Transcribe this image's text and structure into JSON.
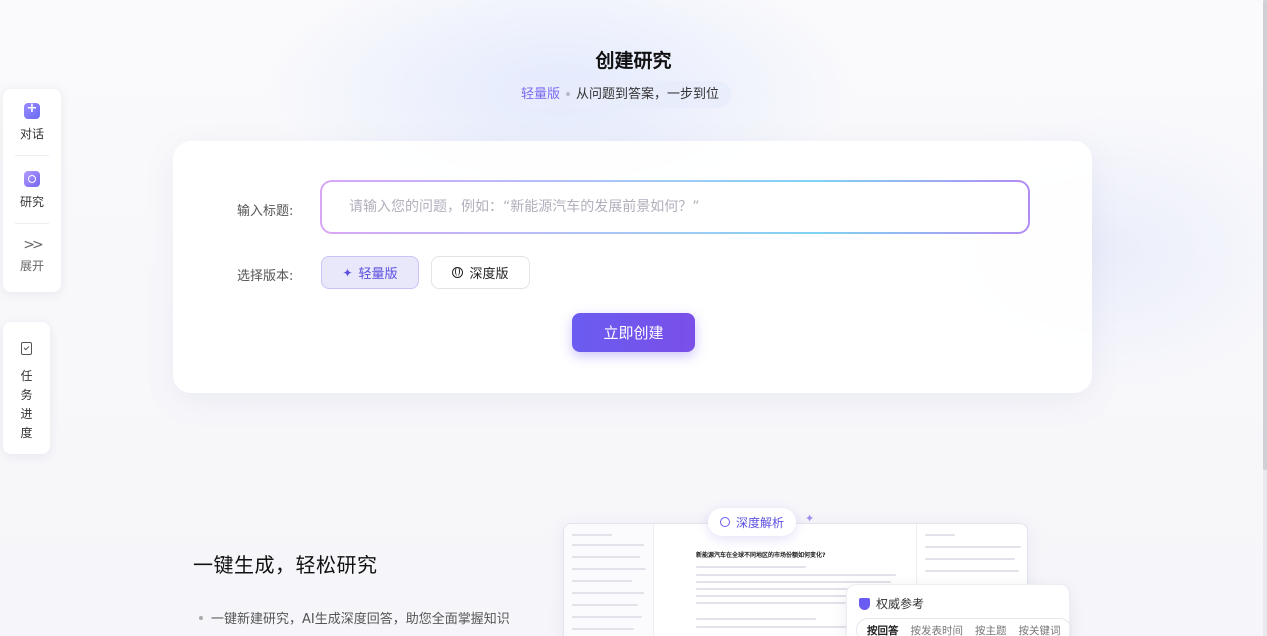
{
  "header": {
    "title": "创建研究",
    "subtitle_version": "轻量版",
    "subtitle_text": "从问题到答案，一步到位"
  },
  "sidebar": {
    "items": [
      {
        "label": "对话",
        "icon": "chat-plus-icon"
      },
      {
        "label": "研究",
        "icon": "research-icon"
      },
      {
        "label": "展开",
        "icon": "double-chevron-right-icon"
      }
    ],
    "task_panel": {
      "label_chars": [
        "任",
        "务",
        "进",
        "度"
      ],
      "icon": "task-doc-icon"
    }
  },
  "form": {
    "title_label": "输入标题:",
    "title_value": "",
    "title_placeholder": "请输入您的问题，例如：“新能源汽车的发展前景如何？”",
    "version_label": "选择版本:",
    "versions": [
      {
        "label": "轻量版",
        "selected": true,
        "icon": "sparkle-icon"
      },
      {
        "label": "深度版",
        "selected": false,
        "icon": "globe-icon"
      }
    ],
    "submit_label": "立即创建"
  },
  "feature": {
    "title": "一键生成，轻松研究",
    "bullets": [
      "一键新建研究，AI生成深度回答，助您全面掌握知识"
    ]
  },
  "preview": {
    "badge": "深度解析",
    "heading": "新能源汽车在全球不同地区的市场份额如何变化?",
    "auth_title": "权威参考",
    "auth_tabs": [
      "按回答",
      "按发表时间",
      "按主题",
      "按关键词"
    ]
  },
  "colors": {
    "accent": "#6a5cf0",
    "accent_light": "#e9e8fb",
    "button_gradient_end": "#7a4fe8"
  }
}
